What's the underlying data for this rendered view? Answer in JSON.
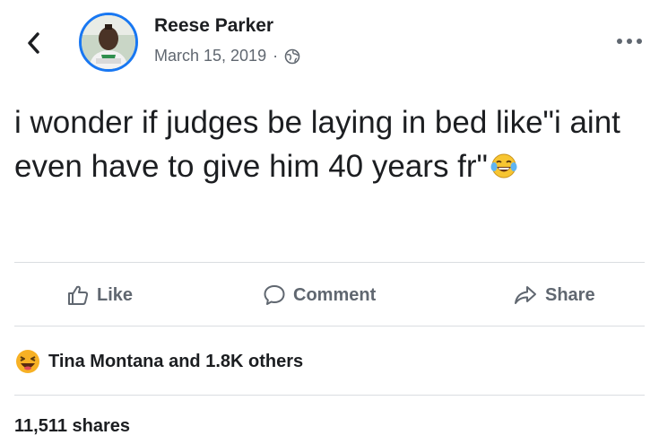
{
  "post": {
    "author": "Reese Parker",
    "date": "March 15, 2019",
    "separator": "·",
    "privacy_icon": "globe-icon",
    "text": "i wonder if judges be laying in bed like\"i aint even have to give him 40 years fr\"",
    "text_emoji": "face-with-tears-of-joy"
  },
  "actions": {
    "like_label": "Like",
    "comment_label": "Comment",
    "share_label": "Share"
  },
  "reactions": {
    "icon": "haha-reaction-icon",
    "summary": "Tina Montana and 1.8K others"
  },
  "shares": {
    "text": "11,511 shares"
  },
  "colors": {
    "accent": "#1877f2",
    "text_primary": "#1c1e21",
    "text_secondary": "#606770",
    "divider": "#dadde1",
    "reaction_yellow": "#f7b125"
  }
}
